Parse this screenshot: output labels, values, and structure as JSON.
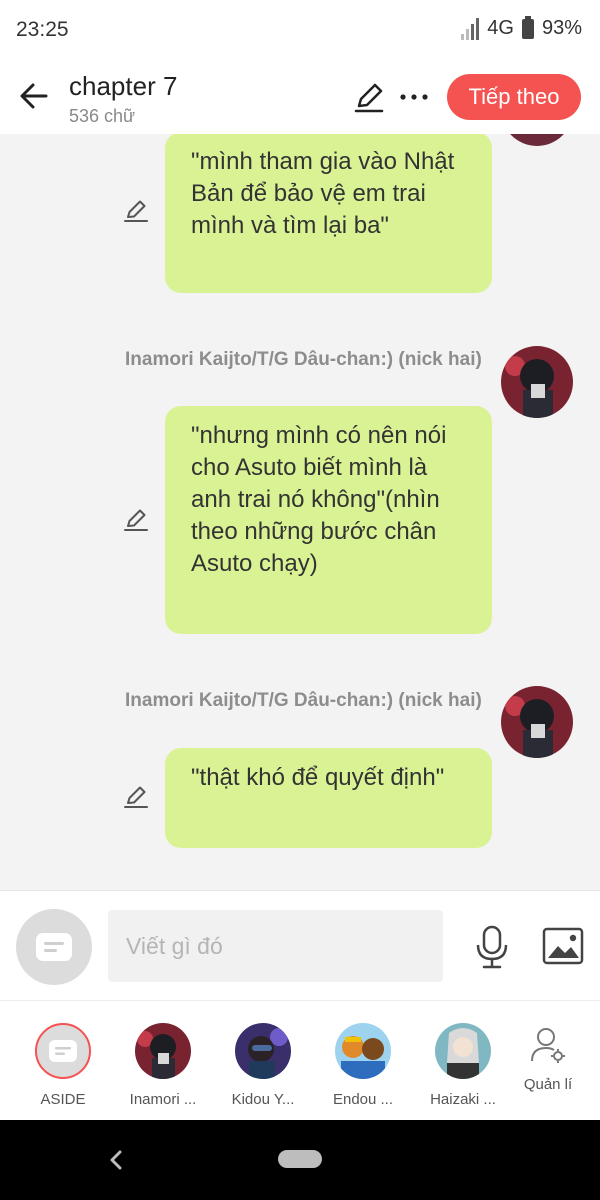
{
  "status_bar": {
    "time": "23:25",
    "network": "4G",
    "battery": "93%"
  },
  "header": {
    "title": "chapter 7",
    "subtitle": "536 chữ",
    "next_label": "Tiếp theo"
  },
  "messages": [
    {
      "text": "\"mình tham gia vào Nhật Bản để bảo vệ em trai mình và tìm lại ba\""
    },
    {
      "sender": "Inamori Kaijto/T/G Dâu-chan:) (nick hai)",
      "text": "\"nhưng mình có nên nói cho Asuto biết mình là anh trai nó không\"(nhìn theo những bước chân Asuto chạy)"
    },
    {
      "sender": "Inamori Kaijto/T/G Dâu-chan:) (nick hai)",
      "text": "\"thật khó để quyết định\""
    }
  ],
  "input": {
    "placeholder": "Viết gì đó"
  },
  "characters": [
    {
      "name": "ASIDE"
    },
    {
      "name": "Inamori ..."
    },
    {
      "name": "Kidou Y..."
    },
    {
      "name": "Endou ..."
    },
    {
      "name": "Haizaki ..."
    }
  ],
  "manage": {
    "label": "Quản lí"
  },
  "colors": {
    "accent": "#f55252",
    "bubble": "#d9f394"
  }
}
